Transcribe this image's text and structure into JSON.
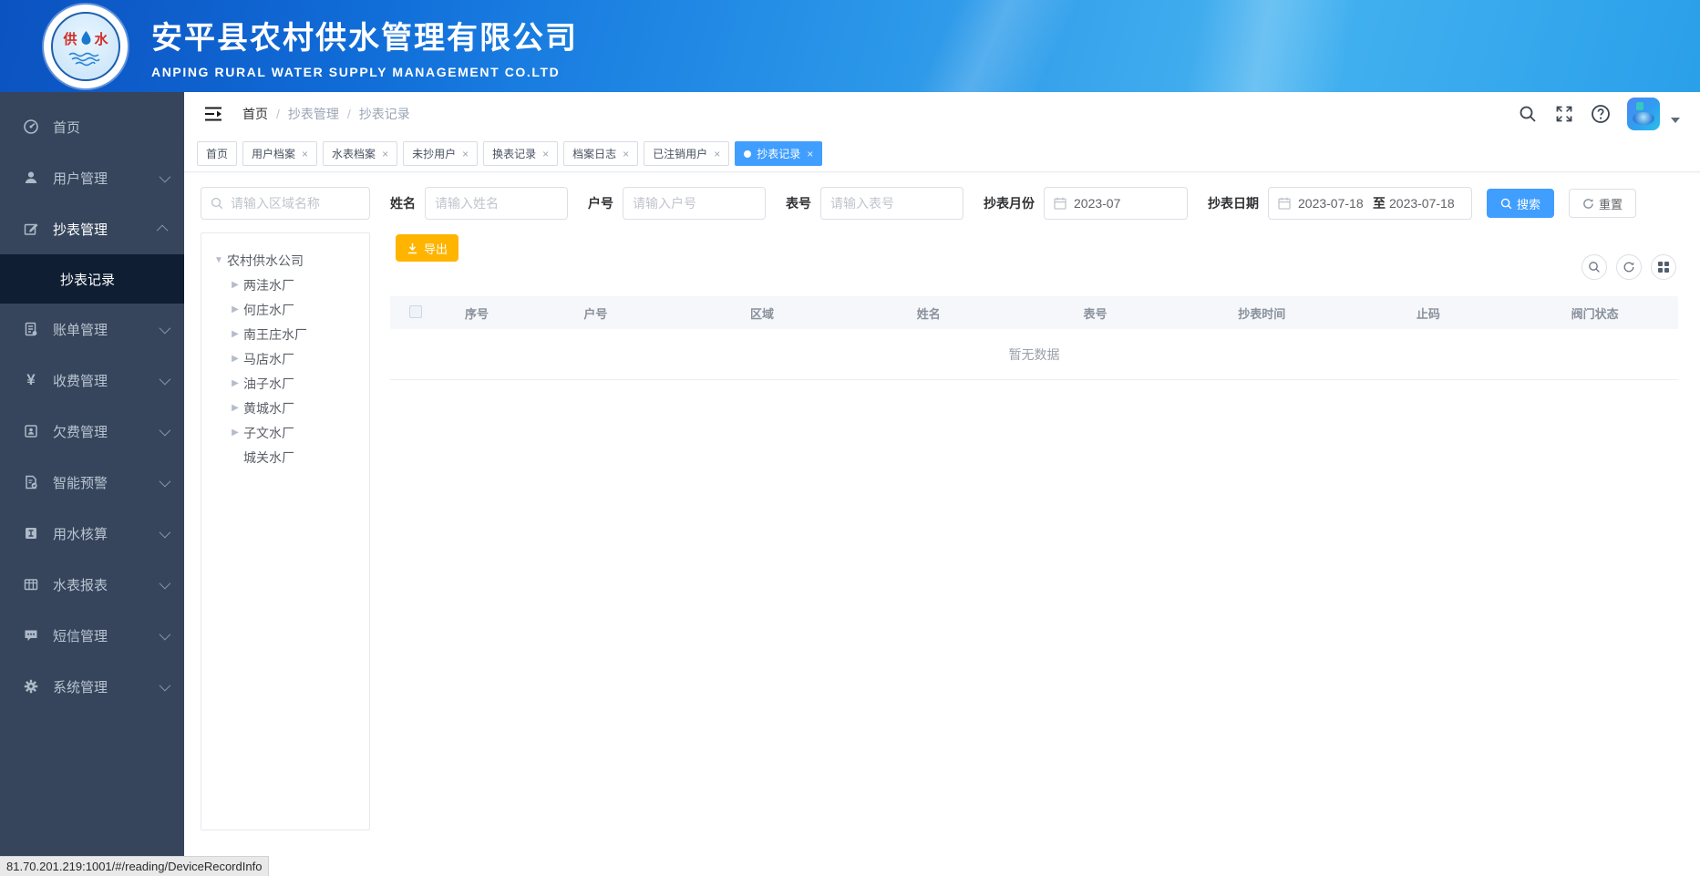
{
  "header": {
    "title": "安平县农村供水管理有限公司",
    "subtitle": "ANPING RURAL WATER SUPPLY MANAGEMENT CO.LTD",
    "logo_char_left": "供",
    "logo_char_right": "水"
  },
  "sidebar": {
    "items": [
      {
        "label": "首页",
        "icon": "dashboard-icon"
      },
      {
        "label": "用户管理",
        "icon": "user-icon"
      },
      {
        "label": "抄表管理",
        "icon": "edit-icon",
        "expanded": true,
        "children": [
          {
            "label": "抄表记录",
            "active": true
          }
        ]
      },
      {
        "label": "账单管理",
        "icon": "bill-icon"
      },
      {
        "label": "收费管理",
        "icon": "yen-icon"
      },
      {
        "label": "欠费管理",
        "icon": "arrears-icon"
      },
      {
        "label": "智能预警",
        "icon": "alert-icon"
      },
      {
        "label": "用水核算",
        "icon": "water-calc-icon"
      },
      {
        "label": "水表报表",
        "icon": "report-icon"
      },
      {
        "label": "短信管理",
        "icon": "sms-icon"
      },
      {
        "label": "系统管理",
        "icon": "gear-icon"
      }
    ]
  },
  "breadcrumb": {
    "separator": "/",
    "items": [
      "首页",
      "抄表管理",
      "抄表记录"
    ]
  },
  "tabs": [
    {
      "label": "首页",
      "closable": false,
      "active": false
    },
    {
      "label": "用户档案",
      "closable": true,
      "active": false
    },
    {
      "label": "水表档案",
      "closable": true,
      "active": false
    },
    {
      "label": "未抄用户",
      "closable": true,
      "active": false
    },
    {
      "label": "换表记录",
      "closable": true,
      "active": false
    },
    {
      "label": "档案日志",
      "closable": true,
      "active": false
    },
    {
      "label": "已注销用户",
      "closable": true,
      "active": false
    },
    {
      "label": "抄表记录",
      "closable": true,
      "active": true
    }
  ],
  "tab_close_glyph": "×",
  "filters": {
    "area_placeholder": "请输入区域名称",
    "name_label": "姓名",
    "name_placeholder": "请输入姓名",
    "account_label": "户号",
    "account_placeholder": "请输入户号",
    "meter_label": "表号",
    "meter_placeholder": "请输入表号",
    "month_label": "抄表月份",
    "month_value": "2023-07",
    "date_label": "抄表日期",
    "date_start": "2023-07-18",
    "date_separator": "至",
    "date_end": "2023-07-18",
    "search_button": "搜索",
    "reset_button": "重置"
  },
  "tree": {
    "root": "农村供水公司",
    "children": [
      "两洼水厂",
      "何庄水厂",
      "南王庄水厂",
      "马店水厂",
      "油子水厂",
      "黄城水厂",
      "子文水厂",
      "城关水厂"
    ],
    "root_caret": "▼",
    "child_caret": "▶"
  },
  "actions": {
    "export_label": "导出"
  },
  "table": {
    "columns": [
      "序号",
      "户号",
      "区域",
      "姓名",
      "表号",
      "抄表时间",
      "止码",
      "阀门状态"
    ],
    "empty_text": "暂无数据"
  },
  "statusbar": {
    "url": "81.70.201.219:1001/#/reading/DeviceRecordInfo"
  },
  "colors": {
    "accent_blue": "#409eff",
    "export_yellow": "#ffb400",
    "sidebar_bg": "#36455c",
    "sidebar_active_bg": "#0f1e33",
    "header_gradient_start": "#0b57cc",
    "header_gradient_end": "#2aa0ea",
    "table_header_bg": "#f5f7fa",
    "placeholder_gray": "#c0c4cc"
  }
}
